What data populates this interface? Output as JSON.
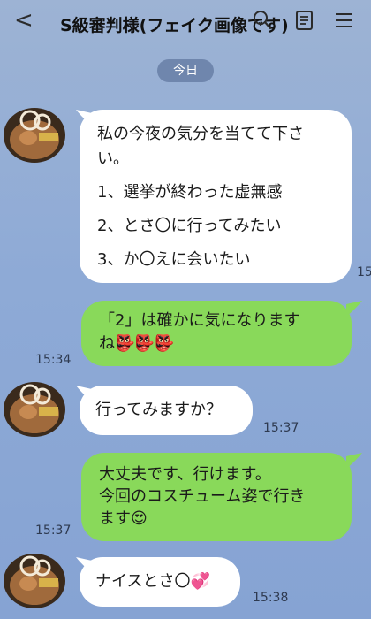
{
  "header": {
    "back_glyph": "<",
    "title": "S級審判様(フェイク画像です)",
    "icons": [
      "search-icon",
      "note-icon",
      "menu-icon"
    ]
  },
  "date_chip": "今日",
  "messages": [
    {
      "side": "left",
      "lines": [
        "私の今夜の気分を当てて下さい。",
        "",
        "1、選挙が終わった虚無感",
        "",
        "2、とさ〇に行ってみたい",
        "",
        "3、か〇えに会いたい"
      ],
      "time": "15"
    },
    {
      "side": "right",
      "lines": [
        "「2」は確かに気になります",
        "ね👺👺👺"
      ],
      "time": "15:34"
    },
    {
      "side": "left",
      "lines": [
        "行ってみますか？"
      ],
      "time": "15:37"
    },
    {
      "side": "right",
      "lines": [
        "大丈夫です、行けます。",
        "今回のコスチューム姿で行き",
        "ます😍"
      ],
      "time": "15:37"
    },
    {
      "side": "left",
      "lines": [
        "ナイスとさ〇💞"
      ],
      "time": "15:38"
    }
  ],
  "colors": {
    "background": "#8eaad6",
    "bubble_green": "#89d95a",
    "bubble_white": "#ffffff",
    "date_chip": "#6f86ad"
  }
}
